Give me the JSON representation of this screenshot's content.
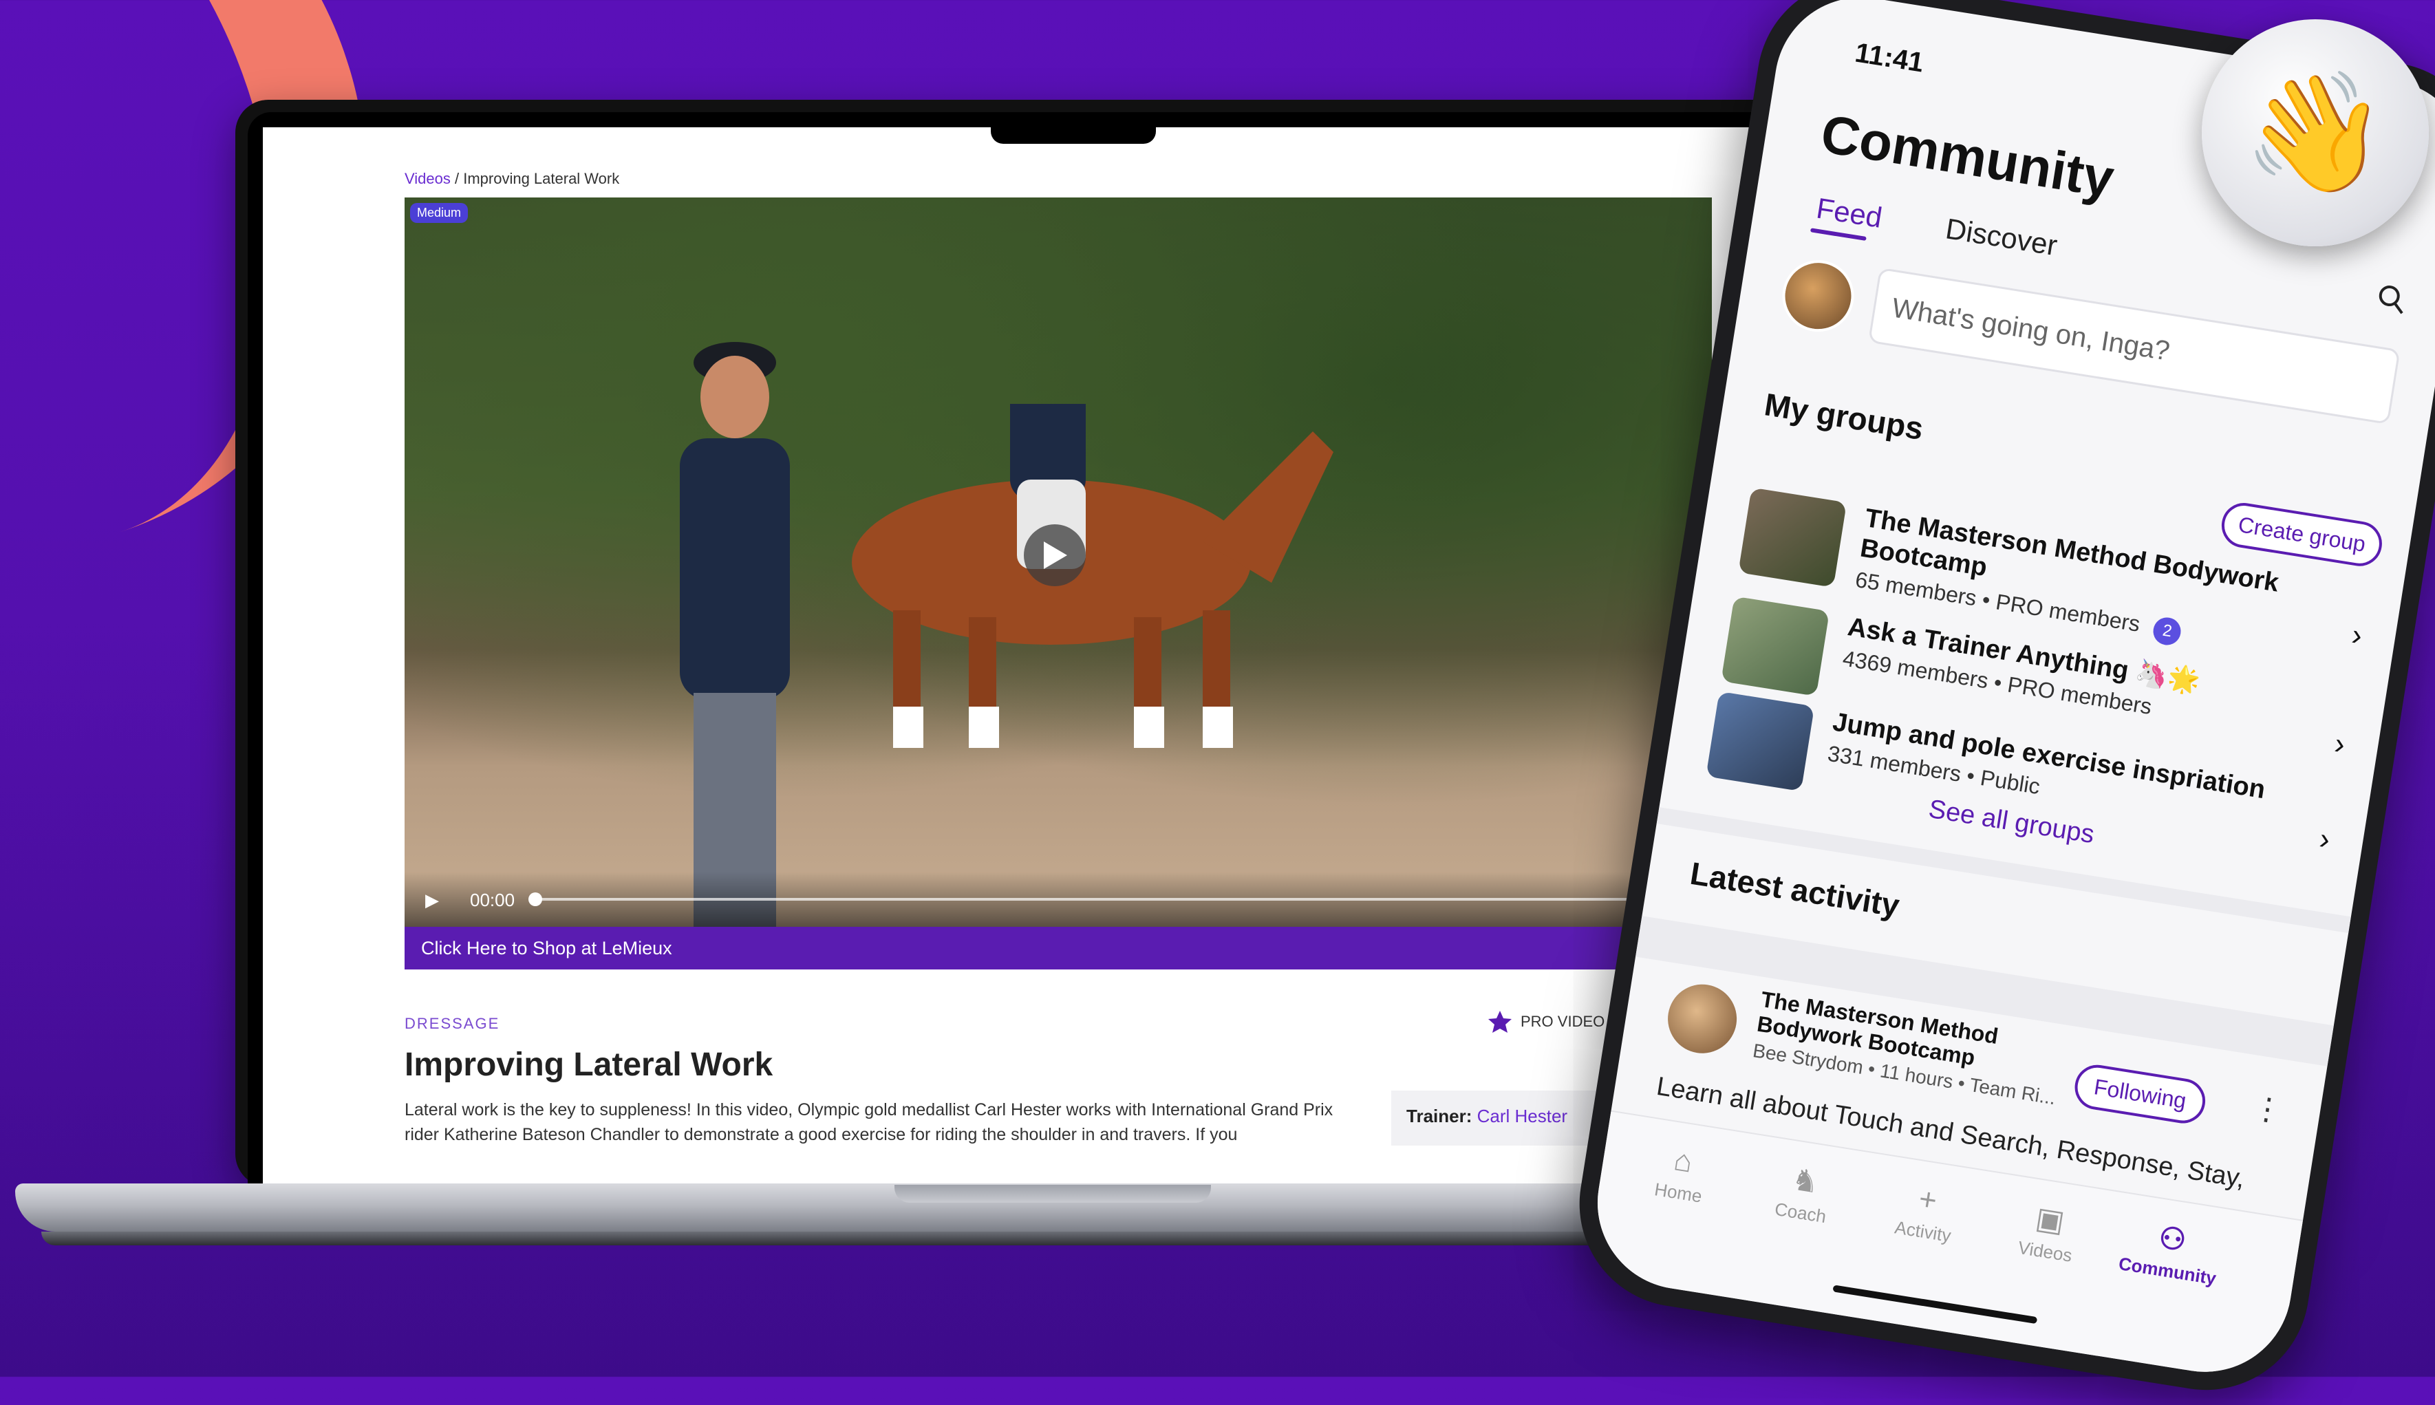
{
  "laptop": {
    "breadcrumb": {
      "link": "Videos",
      "sep": " / ",
      "current": "Improving Lateral Work"
    },
    "video": {
      "difficulty_badge": "Medium",
      "time": "00:00",
      "progress": 0
    },
    "shop_bar": "Click Here to Shop at LeMieux",
    "category": "DRESSAGE",
    "pro_label": "PRO VIDEO",
    "title": "Improving Lateral Work",
    "description": "Lateral work is the key to suppleness! In this video, Olympic gold medallist Carl Hester works with International Grand Prix rider Katherine Bateson Chandler to demonstrate a good exercise for riding the shoulder in and travers. If you",
    "trainer_label": "Trainer:",
    "trainer_name": "Carl Hester"
  },
  "phone": {
    "time": "11:41",
    "title": "Community",
    "tabs": {
      "feed": "Feed",
      "discover": "Discover"
    },
    "compose_placeholder": "What's going on, Inga?",
    "my_groups": "My groups",
    "create_group": "Create group",
    "groups": [
      {
        "name": "The Masterson Method Bodywork Bootcamp",
        "members": "65 members",
        "type": "PRO members",
        "badge": "2"
      },
      {
        "name": "Ask a Trainer Anything 🦄🌟",
        "members": "4369 members",
        "type": "PRO members"
      },
      {
        "name": "Jump and pole exercise inspriation",
        "members": "331 members",
        "type": "Public"
      }
    ],
    "see_all": "See all groups",
    "latest_activity": "Latest activity",
    "activity": {
      "group": "The Masterson Method Bodywork Bootcamp",
      "meta": "Bee Strydom • 11 hours • Team Ri...",
      "follow": "Following",
      "text": "Learn all about Touch and Search, Response, Stay,"
    },
    "tabbar": [
      {
        "label": "Home",
        "icon": "home-icon"
      },
      {
        "label": "Coach",
        "icon": "coach-icon"
      },
      {
        "label": "Activity",
        "icon": "plus-icon"
      },
      {
        "label": "Videos",
        "icon": "videos-icon"
      },
      {
        "label": "Community",
        "icon": "community-icon"
      }
    ],
    "active_tab": "Community",
    "accent": "#5a1cb1"
  },
  "wave_emoji": "👋",
  "colors": {
    "background": "#5410ae",
    "swoosh": "#f27a6a",
    "accent": "#5a1cb1"
  }
}
